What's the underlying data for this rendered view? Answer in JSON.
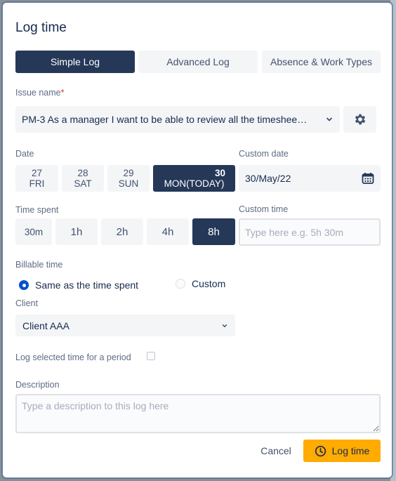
{
  "dialog": {
    "title": "Log time"
  },
  "tabs": [
    {
      "label": "Simple Log",
      "active": true
    },
    {
      "label": "Advanced Log",
      "active": false
    },
    {
      "label": "Absence & Work Types",
      "active": false
    }
  ],
  "issue": {
    "label": "Issue name",
    "required_mark": "*",
    "value": "PM-3 As a manager I want to be able to review all the timeshee…"
  },
  "date": {
    "label": "Date",
    "days": [
      {
        "num": "27",
        "name": "FRI"
      },
      {
        "num": "28",
        "name": "SAT"
      },
      {
        "num": "29",
        "name": "SUN"
      },
      {
        "num": "30",
        "name": "MON(TODAY)",
        "active": true
      }
    ]
  },
  "custom_date": {
    "label": "Custom date",
    "value": "30/May/22"
  },
  "time_spent": {
    "label": "Time spent",
    "options": [
      "30m",
      "1h",
      "2h",
      "4h",
      "8h"
    ],
    "selected": "8h"
  },
  "custom_time": {
    "label": "Custom time",
    "placeholder": "Type here e.g. 5h 30m"
  },
  "billable": {
    "label": "Billable time",
    "option_same": "Same as the time spent",
    "option_custom": "Custom",
    "selected": "same"
  },
  "client": {
    "label": "Client",
    "value": "Client AAA"
  },
  "period": {
    "label": "Log selected time for a period",
    "checked": false
  },
  "description": {
    "label": "Description",
    "placeholder": "Type a description to this log here"
  },
  "footer": {
    "cancel_label": "Cancel",
    "submit_label": "Log time"
  },
  "colors": {
    "primary_dark": "#253858",
    "accent_yellow": "#ffab00",
    "radio_blue": "#0052cc"
  }
}
